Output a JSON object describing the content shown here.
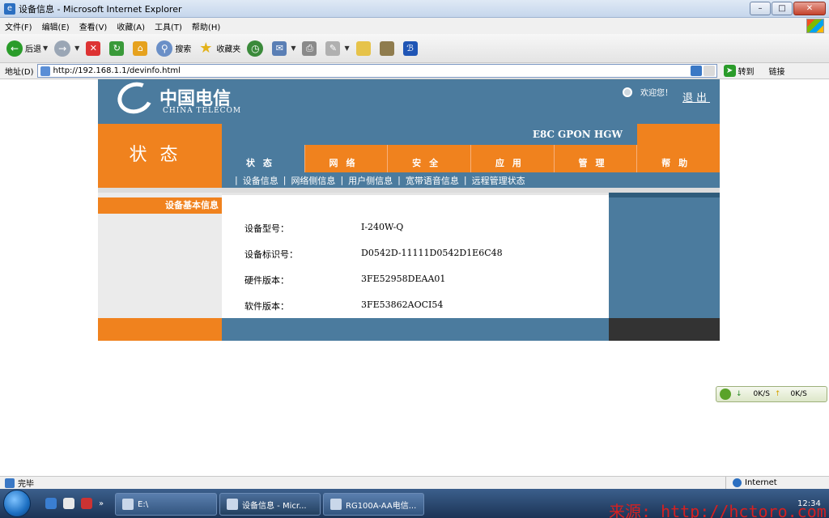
{
  "window": {
    "title": "设备信息 - Microsoft Internet Explorer"
  },
  "menu": {
    "items": [
      "文件(F)",
      "编辑(E)",
      "查看(V)",
      "收藏(A)",
      "工具(T)",
      "帮助(H)"
    ]
  },
  "toolbar": {
    "back_label": "后退",
    "search_label": "搜索",
    "favorites_label": "收藏夹"
  },
  "address": {
    "label": "地址(D)",
    "url": "http://192.168.1.1/devinfo.html",
    "goto_label": "转到",
    "links_label": "链接"
  },
  "router": {
    "logo_cn": "中国电信",
    "logo_en": "CHINA TELECOM",
    "welcome": "欢迎您！",
    "logout": "退出",
    "section_title": "状态",
    "model_banner": "E8C GPON HGW",
    "tabs": [
      "状态",
      "网络",
      "安全",
      "应用",
      "管理",
      "帮助"
    ],
    "active_tab": "状态",
    "subnav": [
      "设备信息",
      "网络侧信息",
      "用户侧信息",
      "宽带语音信息",
      "远程管理状态"
    ],
    "sidebar_heading": "设备基本信息",
    "info": [
      {
        "label": "设备型号：",
        "value": "I-240W-Q"
      },
      {
        "label": "设备标识号：",
        "value": "D0542D-11111D0542D1E6C48"
      },
      {
        "label": "硬件版本：",
        "value": "3FE52958DEAA01"
      },
      {
        "label": "软件版本：",
        "value": "3FE53862AOCI54"
      }
    ]
  },
  "netwidget": {
    "down": "0K/S",
    "up": "0K/S"
  },
  "status": {
    "text": "完毕",
    "zone": "Internet"
  },
  "taskbar": {
    "items": [
      "E:\\",
      "设备信息 - Micr...",
      "RG100A-AA电信..."
    ],
    "clock": "12:34",
    "watermark": "来源: http://hctoro.com"
  },
  "colors": {
    "orange": "#f0821e",
    "steel_blue": "#4b7b9e",
    "dark": "#333333"
  }
}
